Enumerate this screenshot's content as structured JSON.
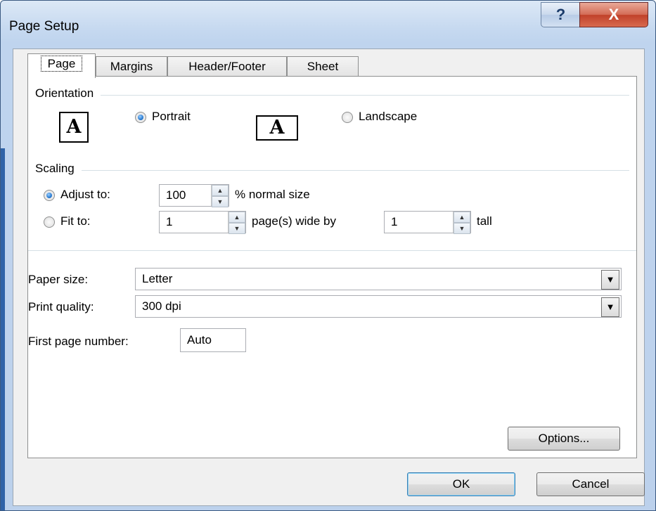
{
  "window": {
    "title": "Page Setup",
    "help_glyph": "?",
    "close_glyph": "X"
  },
  "tabs": [
    {
      "label": "Page",
      "active": true
    },
    {
      "label": "Margins",
      "active": false
    },
    {
      "label": "Header/Footer",
      "active": false
    },
    {
      "label": "Sheet",
      "active": false
    }
  ],
  "orientation": {
    "heading": "Orientation",
    "portrait_label": "Portrait",
    "landscape_label": "Landscape",
    "icon_letter": "A",
    "selected": "portrait"
  },
  "scaling": {
    "heading": "Scaling",
    "adjust_label": "Adjust to:",
    "adjust_value": "100",
    "adjust_suffix": "% normal size",
    "fit_label": "Fit to:",
    "fit_wide_value": "1",
    "fit_wide_suffix": "page(s) wide by",
    "fit_tall_value": "1",
    "fit_tall_suffix": "tall",
    "selected": "adjust"
  },
  "paper_size": {
    "label": "Paper size:",
    "value": "Letter"
  },
  "print_quality": {
    "label": "Print quality:",
    "value": "300 dpi"
  },
  "first_page_number": {
    "label": "First page number:",
    "value": "Auto"
  },
  "buttons": {
    "options": "Options...",
    "ok": "OK",
    "cancel": "Cancel"
  },
  "colors": {
    "title_bar": "#c6d9f0",
    "close_button": "#c0412a",
    "radio_selected": "#2a7bd1"
  },
  "icons": {
    "help": "question-mark-icon",
    "close": "close-icon",
    "spin_up": "chevron-up-icon",
    "spin_down": "chevron-down-icon",
    "dropdown": "triangle-down-icon",
    "portrait_page": "portrait-page-icon",
    "landscape_page": "landscape-page-icon"
  }
}
